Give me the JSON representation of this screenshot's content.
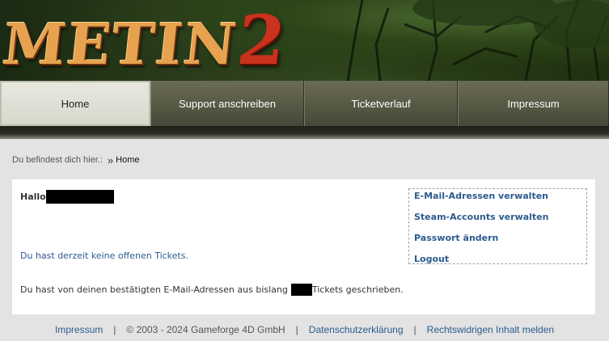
{
  "header": {
    "logo_text": "METIN",
    "logo_number": "2"
  },
  "nav": {
    "items": [
      {
        "label": "Home",
        "active": true
      },
      {
        "label": "Support anschreiben"
      },
      {
        "label": "Ticketverlauf"
      },
      {
        "label": "Impressum"
      }
    ]
  },
  "breadcrumb": {
    "prefix": "Du befindest dich hier.:",
    "separator": "»",
    "current": "Home"
  },
  "main": {
    "greeting": "Hallo",
    "no_tickets_link": "Du hast derzeit keine offenen Tickets.",
    "summary_before": "Du hast von deinen bestätigten E-Mail-Adressen aus bislang",
    "summary_after": "Tickets geschrieben."
  },
  "sidebar": {
    "links": [
      "E-Mail-Adressen verwalten",
      "Steam-Accounts verwalten",
      "Passwort ändern",
      "Logout"
    ]
  },
  "footer": {
    "impressum": "Impressum",
    "copyright": "© 2003 - 2024 Gameforge 4D GmbH",
    "privacy": "Datenschutzerklärung",
    "report": "Rechtswidrigen Inhalt melden",
    "separator": "|"
  },
  "colors": {
    "link": "#2c5b8e",
    "nav_bg": "#595a45",
    "logo": "#e6a24f",
    "logo_accent": "#c9321d"
  }
}
